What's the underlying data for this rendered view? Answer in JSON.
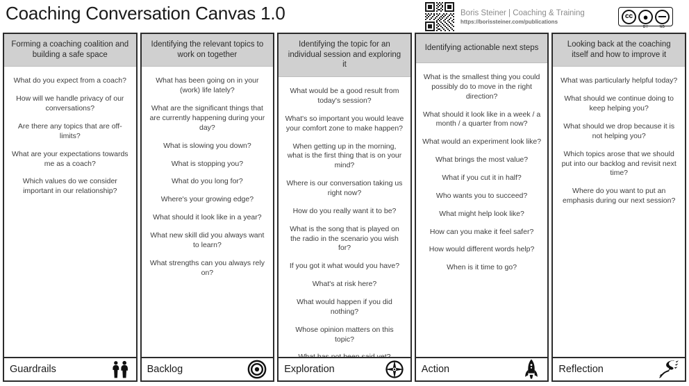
{
  "header": {
    "title": "Coaching Conversation Canvas 1.0",
    "attribution_name": "Boris Steiner | Coaching & Training",
    "attribution_url": "https://borissteiner.com/publications",
    "qr_icon": "qr-code-icon",
    "license": {
      "name": "cc-by-nd-badge",
      "cc_label": "cc",
      "by_label": "BY",
      "nd_label": "ND"
    }
  },
  "columns": [
    {
      "key": "guardrails",
      "heading": "Forming a coaching coalition and building a safe space",
      "footer_label": "Guardrails",
      "footer_icon": "two-people-icon",
      "questions": [
        "What do you expect from a coach?",
        "How will we handle privacy of our conversations?",
        "Are there any topics that are off-limits?",
        "What are your expectations towards me as a coach?",
        "Which values do we consider important in our relationship?"
      ]
    },
    {
      "key": "backlog",
      "heading": "Identifying the relevant topics to work on together",
      "footer_label": "Backlog",
      "footer_icon": "target-icon",
      "questions": [
        "What has been going on in your (work) life lately?",
        "What are the significant things that are currently happening during your day?",
        "What is slowing you down?",
        "What is stopping you?",
        "What do you long for?",
        "Where's your growing edge?",
        "What should it look like in a year?",
        "What new skill did you always want to learn?",
        "What strengths can you always rely on?"
      ]
    },
    {
      "key": "exploration",
      "heading": "Identifying the topic for an individual session and exploring it",
      "footer_label": "Exploration",
      "footer_icon": "compass-icon",
      "questions": [
        "What would be a good result from today's session?",
        "What's so important you would leave your comfort zone to make happen?",
        "When getting up in the morning, what is the first thing that is on your mind?",
        "Where is our conversation taking us right now?",
        "How do you really want it to be?",
        "What is the song that is played on the radio in the scenario you wish for?",
        "If you got it what would you have?",
        "What's at risk here?",
        "What would happen if you did nothing?",
        "Whose opinion matters on this topic?",
        "What has not been said yet?"
      ]
    },
    {
      "key": "action",
      "heading": "Identifying actionable next steps",
      "footer_label": "Action",
      "footer_icon": "rocket-icon",
      "questions": [
        "What is the smallest thing you could possibly do to move in the right direction?",
        "What should it look like in a week / a month / a quarter from now?",
        "What would an experiment look like?",
        "What brings the most value?",
        "What if you cut it in half?",
        "Who wants you to succeed?",
        "What might help look like?",
        "How can you make it feel safer?",
        "How would different words help?",
        "When is it time to go?"
      ]
    },
    {
      "key": "reflection",
      "heading": "Looking back at the coaching itself and how to improve it",
      "footer_label": "Reflection",
      "footer_icon": "winding-road-icon",
      "questions": [
        "What was particularly helpful today?",
        "What should we continue doing to keep helping you?",
        "What should we drop because it is not helping you?",
        "Which topics arose that we should put into our backlog and revisit next time?",
        "Where do you want to put an emphasis during our next session?"
      ]
    }
  ],
  "colors": {
    "heading_background": "#d0d0d0",
    "border": "#2b2b2b",
    "text": "#3d3d3d",
    "canvas_background": "#ffffff"
  }
}
